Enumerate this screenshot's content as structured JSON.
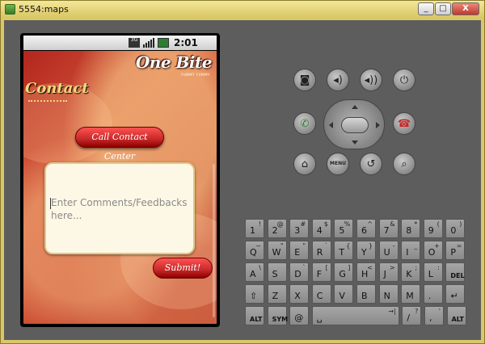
{
  "window": {
    "title": "5554:maps",
    "min": "_",
    "max": "□",
    "close": "X"
  },
  "status": {
    "time": "2:01 PM",
    "network": "3G"
  },
  "app": {
    "brand": "One Bite",
    "tagline": "YUMMY YUMMY",
    "heading": "Contact",
    "call_button": "Call Contact Center",
    "comment_placeholder": "Enter Comments/Feedbacks here...",
    "submit_button": "Submit!"
  },
  "controls": {
    "menu_label": "MENU"
  },
  "keyboard": {
    "row1": [
      {
        "main": "1",
        "alt": "!"
      },
      {
        "main": "2",
        "alt": "@"
      },
      {
        "main": "3",
        "alt": "#"
      },
      {
        "main": "4",
        "alt": "$"
      },
      {
        "main": "5",
        "alt": "%"
      },
      {
        "main": "6",
        "alt": "^"
      },
      {
        "main": "7",
        "alt": "&"
      },
      {
        "main": "8",
        "alt": "*"
      },
      {
        "main": "9",
        "alt": "("
      },
      {
        "main": "0",
        "alt": ")"
      }
    ],
    "row2": [
      {
        "main": "Q",
        "alt": "~"
      },
      {
        "main": "W",
        "alt": "\""
      },
      {
        "main": "E",
        "alt": "\""
      },
      {
        "main": "R",
        "alt": "`"
      },
      {
        "main": "T",
        "alt": "{"
      },
      {
        "main": "Y",
        "alt": "}"
      },
      {
        "main": "U",
        "alt": "-"
      },
      {
        "main": "I",
        "alt": "_"
      },
      {
        "main": "O",
        "alt": "+"
      },
      {
        "main": "P",
        "alt": "="
      }
    ],
    "row3": [
      {
        "main": "A",
        "alt": "\\"
      },
      {
        "main": "S",
        "alt": ""
      },
      {
        "main": "D",
        "alt": "`"
      },
      {
        "main": "F",
        "alt": "["
      },
      {
        "main": "G",
        "alt": "]"
      },
      {
        "main": "H",
        "alt": "<"
      },
      {
        "main": "J",
        "alt": ">"
      },
      {
        "main": "K",
        "alt": ";"
      },
      {
        "main": "L",
        "alt": ":"
      },
      {
        "main": "DEL",
        "alt": ""
      }
    ],
    "row4": [
      {
        "main": "⇧",
        "alt": ""
      },
      {
        "main": "Z",
        "alt": ""
      },
      {
        "main": "X",
        "alt": ""
      },
      {
        "main": "C",
        "alt": ""
      },
      {
        "main": "V",
        "alt": ""
      },
      {
        "main": "B",
        "alt": ""
      },
      {
        "main": "N",
        "alt": ""
      },
      {
        "main": "M",
        "alt": ""
      },
      {
        "main": ".",
        "alt": ""
      },
      {
        "main": "↵",
        "alt": ""
      }
    ],
    "row5": [
      {
        "main": "ALT",
        "alt": ""
      },
      {
        "main": "SYM",
        "alt": ""
      },
      {
        "main": "@",
        "alt": ""
      },
      {
        "main": "␣",
        "alt": "→|"
      },
      {
        "main": "/",
        "alt": "?"
      },
      {
        "main": ",",
        "alt": "'"
      },
      {
        "main": "ALT",
        "alt": ""
      }
    ]
  }
}
